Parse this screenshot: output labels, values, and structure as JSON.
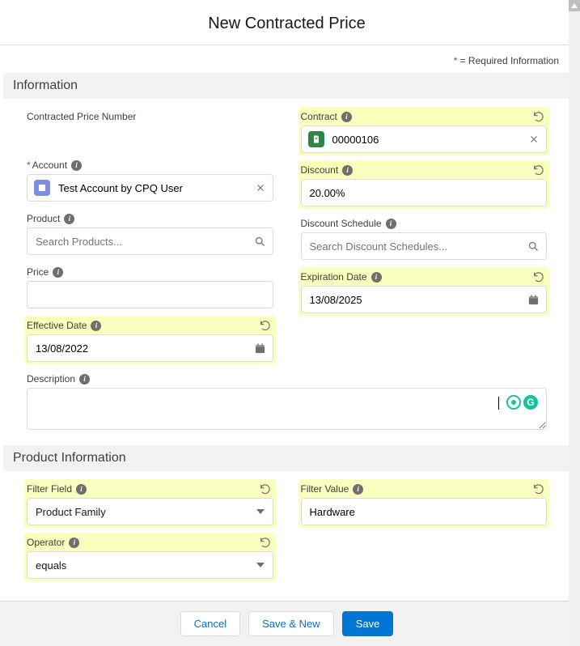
{
  "title": "New Contracted Price",
  "required_note": "= Required Information",
  "sections": {
    "info": "Information",
    "product_info": "Product Information"
  },
  "labels": {
    "contracted_price_number": "Contracted Price Number",
    "account": "Account",
    "product": "Product",
    "price": "Price",
    "effective_date": "Effective Date",
    "description": "Description",
    "contract": "Contract",
    "discount": "Discount",
    "discount_schedule": "Discount Schedule",
    "expiration_date": "Expiration Date",
    "filter_field": "Filter Field",
    "operator": "Operator",
    "filter_value": "Filter Value"
  },
  "values": {
    "account": "Test Account by CPQ User",
    "contract": "00000106",
    "discount": "20.00%",
    "effective_date": "13/08/2022",
    "expiration_date": "13/08/2025",
    "filter_field": "Product Family",
    "operator": "equals",
    "filter_value": "Hardware"
  },
  "placeholders": {
    "product": "Search Products...",
    "discount_schedule": "Search Discount Schedules..."
  },
  "buttons": {
    "cancel": "Cancel",
    "save_new": "Save & New",
    "save": "Save"
  },
  "grammarly_letter": "G"
}
